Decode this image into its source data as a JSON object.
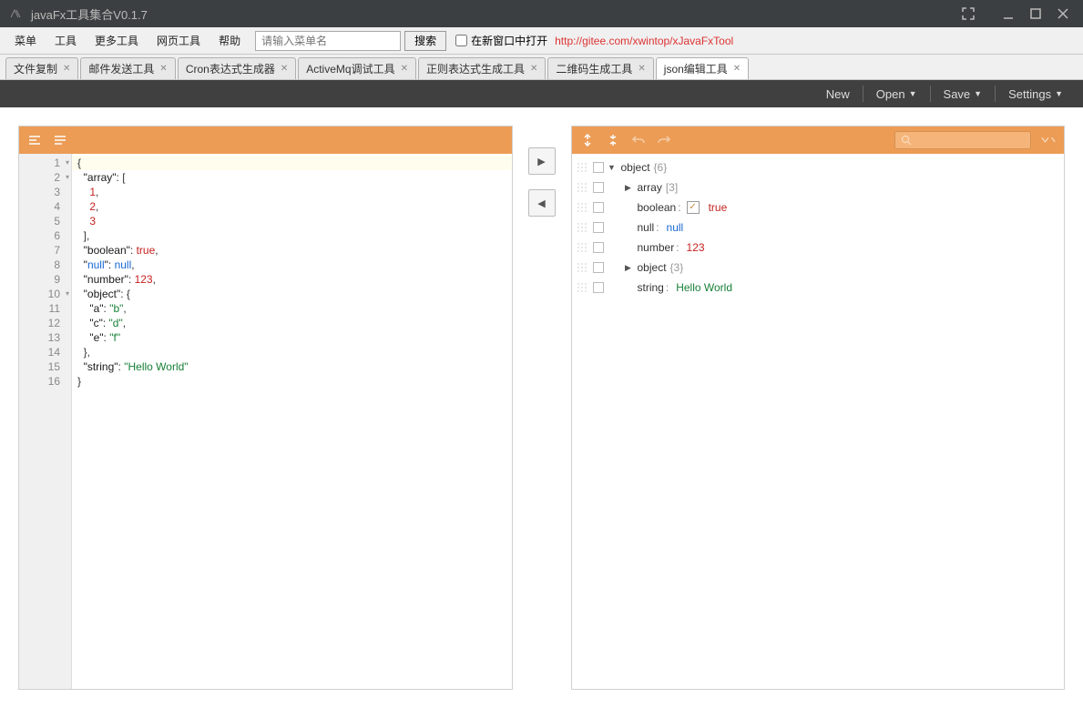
{
  "window": {
    "title": "javaFx工具集合V0.1.7"
  },
  "menubar": {
    "items": [
      "菜单",
      "工具",
      "更多工具",
      "网页工具",
      "帮助"
    ],
    "search_placeholder": "请输入菜单名",
    "search_btn": "搜索",
    "checkbox_label": "在新窗口中打开",
    "link_text": "http://gitee.com/xwintop/xJavaFxTool"
  },
  "tabs": [
    {
      "label": "文件复制"
    },
    {
      "label": "邮件发送工具"
    },
    {
      "label": "Cron表达式生成器"
    },
    {
      "label": "ActiveMq调试工具"
    },
    {
      "label": "正则表达式生成工具"
    },
    {
      "label": "二维码生成工具"
    },
    {
      "label": "json编辑工具",
      "active": true
    }
  ],
  "json_toolbar": {
    "new": "New",
    "open": "Open",
    "save": "Save",
    "settings": "Settings"
  },
  "editor": {
    "lines": [
      {
        "n": 1,
        "fold": true,
        "hl": true,
        "txt": "{"
      },
      {
        "n": 2,
        "fold": true,
        "txt": "  \"array\": ["
      },
      {
        "n": 3,
        "txt": "    1,"
      },
      {
        "n": 4,
        "txt": "    2,"
      },
      {
        "n": 5,
        "txt": "    3"
      },
      {
        "n": 6,
        "txt": "  ],"
      },
      {
        "n": 7,
        "txt": "  \"boolean\": true,"
      },
      {
        "n": 8,
        "txt": "  \"null\": null,"
      },
      {
        "n": 9,
        "txt": "  \"number\": 123,"
      },
      {
        "n": 10,
        "fold": true,
        "txt": "  \"object\": {"
      },
      {
        "n": 11,
        "txt": "    \"a\": \"b\","
      },
      {
        "n": 12,
        "txt": "    \"c\": \"d\","
      },
      {
        "n": 13,
        "txt": "    \"e\": \"f\""
      },
      {
        "n": 14,
        "txt": "  },"
      },
      {
        "n": 15,
        "txt": "  \"string\": \"Hello World\""
      },
      {
        "n": 16,
        "txt": "}"
      }
    ]
  },
  "tree": {
    "root": {
      "key": "object",
      "count": "{6}"
    },
    "rows": [
      {
        "key": "array",
        "count": "[3]",
        "expandable": true
      },
      {
        "key": "boolean",
        "valType": "bool",
        "val": "true",
        "checkbox": true
      },
      {
        "key": "null",
        "valType": "null",
        "val": "null"
      },
      {
        "key": "number",
        "valType": "num",
        "val": "123"
      },
      {
        "key": "object",
        "count": "{3}",
        "expandable": true
      },
      {
        "key": "string",
        "valType": "str",
        "val": "Hello World"
      }
    ]
  }
}
